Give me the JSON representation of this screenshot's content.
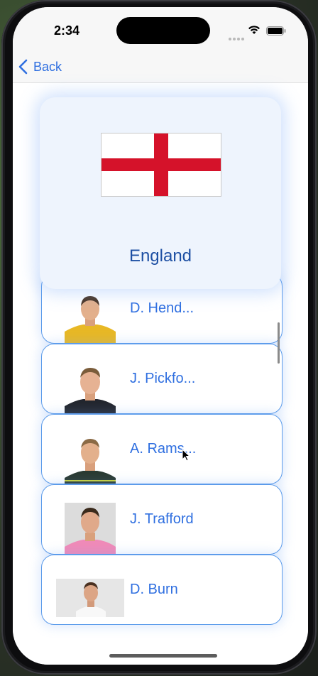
{
  "status_bar": {
    "time": "2:34",
    "wifi_icon": "wifi-icon",
    "battery_icon": "battery-icon"
  },
  "nav": {
    "back_label": "Back",
    "back_icon": "chevron-left-icon",
    "accent_color": "#2f6fe0"
  },
  "team": {
    "name": "England",
    "flag_icon": "england-flag-icon",
    "flag_colors": {
      "field": "#ffffff",
      "cross": "#d5122a"
    }
  },
  "players": [
    {
      "name": "D. Hend...",
      "kit": "yellow-goalkeeper-kit"
    },
    {
      "name": "J. Pickfo...",
      "kit": "dark-kit"
    },
    {
      "name": "A. Rams...",
      "kit": "dark-kit"
    },
    {
      "name": "J. Trafford",
      "kit": "pink-kit"
    },
    {
      "name": "D. Burn",
      "kit": "white-shirt"
    }
  ]
}
